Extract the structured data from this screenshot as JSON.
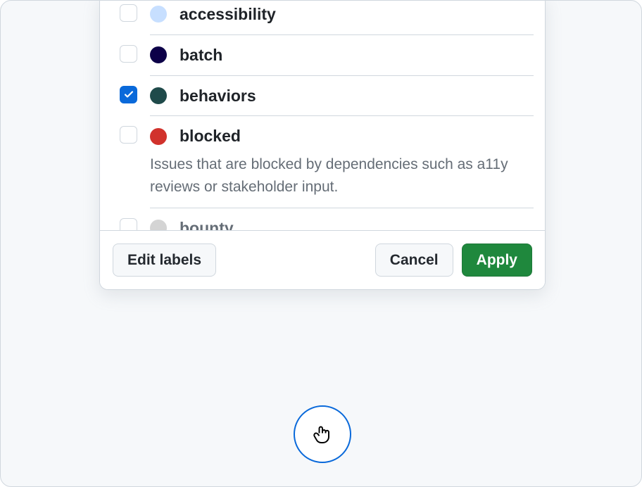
{
  "labels": [
    {
      "name": "accessibility",
      "color": "#c7dfff",
      "checked": false,
      "description": ""
    },
    {
      "name": "batch",
      "color": "#0c0048",
      "checked": false,
      "description": ""
    },
    {
      "name": "behaviors",
      "color": "#1f4a4a",
      "checked": true,
      "description": ""
    },
    {
      "name": "blocked",
      "color": "#d1322c",
      "checked": false,
      "description": "Issues that are blocked by dependencies such as a11y reviews or stakeholder input."
    },
    {
      "name": "bounty",
      "color": "#b1b1b1",
      "checked": false,
      "description": "",
      "faded": true
    }
  ],
  "footer": {
    "edit_labels": "Edit labels",
    "cancel": "Cancel",
    "apply": "Apply"
  }
}
